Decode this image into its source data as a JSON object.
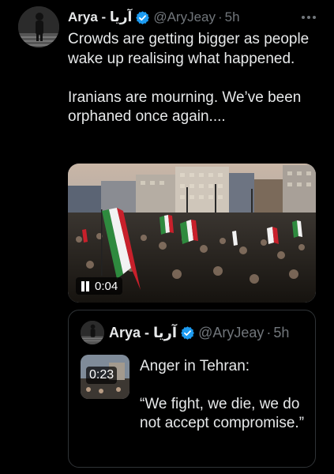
{
  "tweet": {
    "author": {
      "name": "Arya - آریا",
      "handle": "@AryJeay",
      "time": "5h",
      "verified": true
    },
    "more_icon": "more-horizontal-icon",
    "text": [
      "Crowds are getting bigger as people wake up realising what happened.",
      "Iranians are mourning. We’ve been orphaned once again...."
    ],
    "media": {
      "type": "video",
      "duration": "0:04",
      "state_icon": "pause-icon"
    }
  },
  "quoted_tweet": {
    "author": {
      "name": "Arya - آریا",
      "handle": "@AryJeay",
      "time": "5h",
      "verified": true
    },
    "thumbnail_duration": "0:23",
    "text": [
      "Anger in Tehran:",
      "“We fight, we die, we do not accept compromise.”"
    ]
  },
  "colors": {
    "background": "#000000",
    "text": "#e7e9ea",
    "muted": "#71767b",
    "verified_badge": "#1d9bf0",
    "border": "#2f3336"
  }
}
